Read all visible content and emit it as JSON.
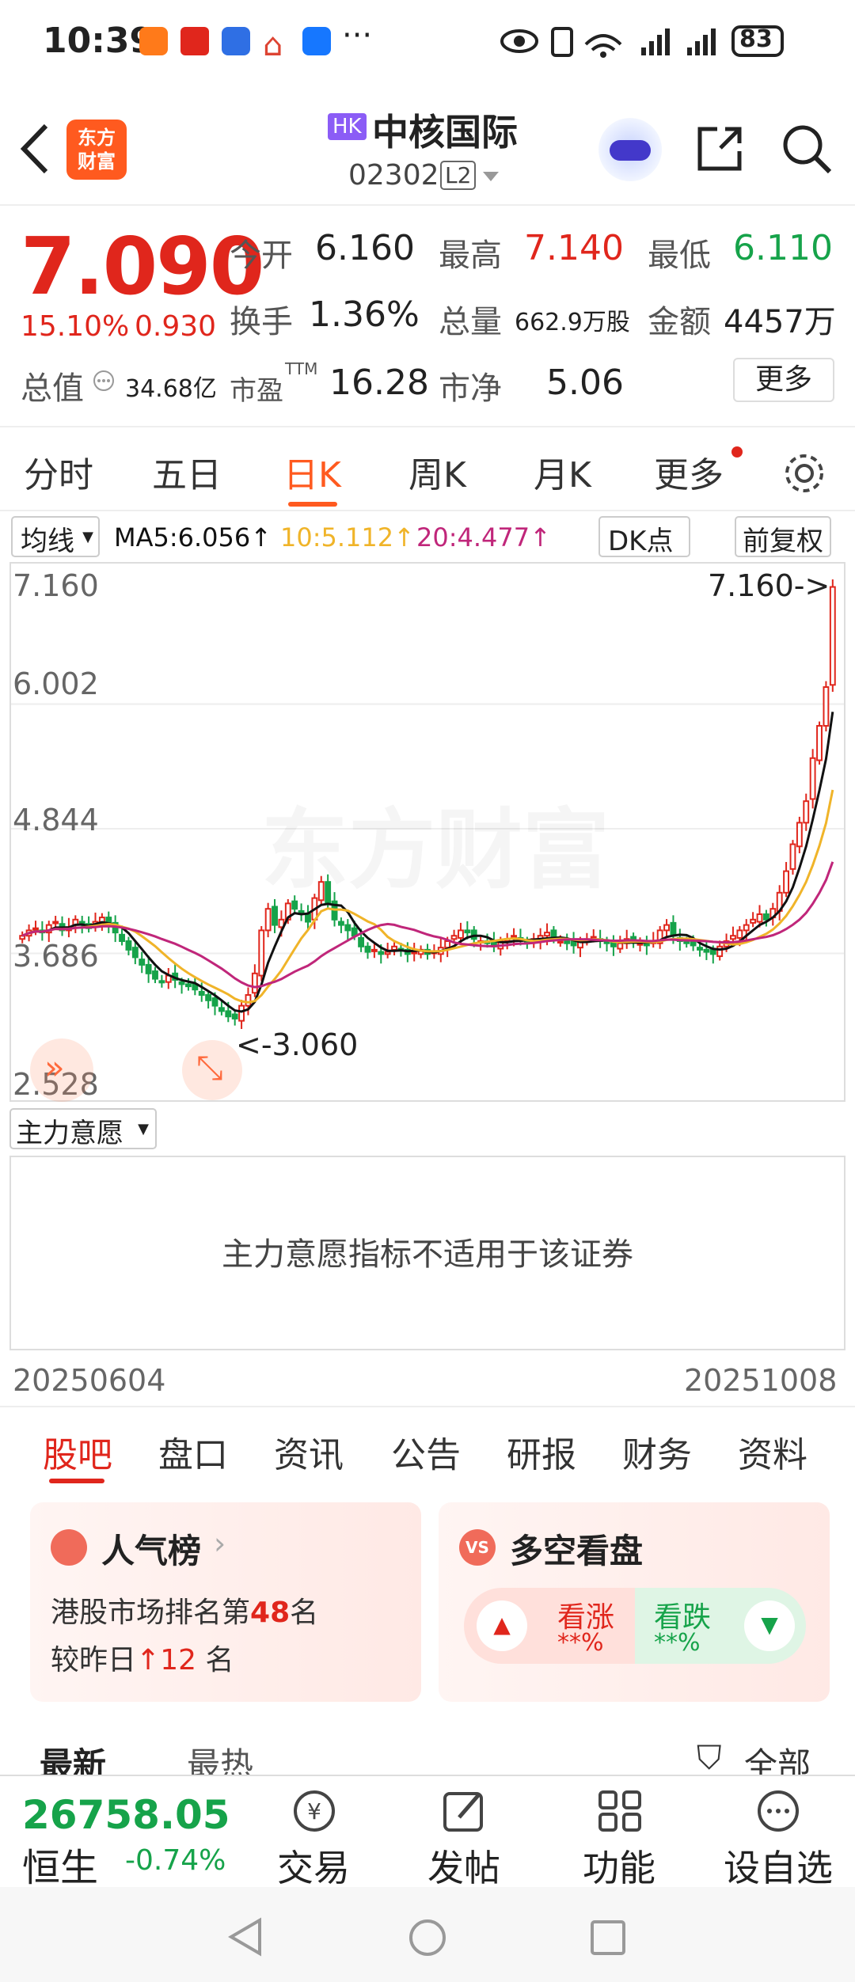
{
  "status_bar": {
    "time": "10:39",
    "more": "···",
    "battery": "83"
  },
  "header": {
    "logo_text": "东方\n财富",
    "market_badge": "HK",
    "stock_name": "中核国际",
    "stock_code": "02302",
    "level_badge": "L2"
  },
  "quote": {
    "price": "7.090",
    "change_pct": "15.10%",
    "change_amt": "0.930",
    "open_label": "今开",
    "open": "6.160",
    "high_label": "最高",
    "high": "7.140",
    "low_label": "最低",
    "low": "6.110",
    "turnover_label": "换手",
    "turnover": "1.36%",
    "volume_label": "总量",
    "volume": "662.9万股",
    "amount_label": "金额",
    "amount": "4457万",
    "mktcap_label": "总值",
    "mktcap": "34.68亿",
    "pe_label": "市盈",
    "pe_sup": "TTM",
    "pe": "16.28",
    "pb_label": "市净",
    "pb": "5.06",
    "more_button": "更多"
  },
  "periods": {
    "items": [
      "分时",
      "五日",
      "日K",
      "周K",
      "月K",
      "更多"
    ],
    "active": "日K"
  },
  "chart_toolbar": {
    "ma_select": "均线",
    "ma5": "MA5:6.056↑",
    "ma10": "10:5.112↑",
    "ma20": "20:4.477↑",
    "dk_button": "DK点",
    "adjust_button": "前复权",
    "colors": {
      "ma5": "#111111",
      "ma10": "#f0b429",
      "ma20": "#c0267a",
      "up": "#e0261c",
      "down": "#16a34a"
    }
  },
  "chart_data": {
    "type": "candlestick",
    "y_ticks": [
      "7.160",
      "6.002",
      "4.844",
      "3.686",
      "2.528"
    ],
    "ylim": [
      2.528,
      7.16
    ],
    "max_marker": "7.160->",
    "min_marker": "<-3.060",
    "watermark": "东方财富",
    "x_start": "20250604",
    "x_end": "20251008",
    "close": [
      3.85,
      3.9,
      3.92,
      3.88,
      3.95,
      3.98,
      3.9,
      3.93,
      4.0,
      3.96,
      3.92,
      3.98,
      4.02,
      3.95,
      3.88,
      3.8,
      3.72,
      3.65,
      3.58,
      3.5,
      3.45,
      3.42,
      3.48,
      3.44,
      3.4,
      3.38,
      3.35,
      3.3,
      3.25,
      3.2,
      3.15,
      3.1,
      3.08,
      3.2,
      3.3,
      3.5,
      3.9,
      4.1,
      3.95,
      4.0,
      4.15,
      4.1,
      4.05,
      3.98,
      4.2,
      4.35,
      4.15,
      4.0,
      3.95,
      3.9,
      3.85,
      3.75,
      3.7,
      3.72,
      3.68,
      3.7,
      3.75,
      3.72,
      3.68,
      3.7,
      3.72,
      3.68,
      3.7,
      3.74,
      3.8,
      3.85,
      3.9,
      3.88,
      3.82,
      3.8,
      3.78,
      3.75,
      3.8,
      3.82,
      3.85,
      3.8,
      3.78,
      3.82,
      3.85,
      3.88,
      3.82,
      3.8,
      3.78,
      3.76,
      3.8,
      3.82,
      3.84,
      3.8,
      3.78,
      3.75,
      3.78,
      3.82,
      3.8,
      3.78,
      3.76,
      3.8,
      3.9,
      3.95,
      3.85,
      3.8,
      3.78,
      3.76,
      3.72,
      3.7,
      3.68,
      3.75,
      3.8,
      3.85,
      3.9,
      3.95,
      4.0,
      4.05,
      4.0,
      4.1,
      4.25,
      4.45,
      4.7,
      4.9,
      5.1,
      5.5,
      5.8,
      6.16,
      7.09
    ],
    "ma5_last": 6.056,
    "ma10_last": 5.112,
    "ma20_last": 4.477
  },
  "indicator": {
    "select": "主力意愿",
    "message": "主力意愿指标不适用于该证券"
  },
  "info_tabs": {
    "items": [
      "股吧",
      "盘口",
      "资讯",
      "公告",
      "研报",
      "财务",
      "资料"
    ],
    "active": "股吧"
  },
  "cards": {
    "popularity": {
      "title": "人气榜",
      "line1_prefix": "港股市场排名第",
      "rank": "48",
      "line1_suffix": "名",
      "line2_prefix": "较昨日",
      "change": "12",
      "line2_suffix": "名"
    },
    "bullbear": {
      "title": "多空看盘",
      "up_label": "看涨",
      "up_pct": "**%",
      "down_label": "看跌",
      "down_pct": "**%"
    }
  },
  "sort": {
    "latest": "最新",
    "hot": "最热",
    "filter": "全部"
  },
  "bottom_nav": {
    "index_value": "26758.05",
    "index_name": "恒生",
    "index_change": "-0.74%",
    "items": [
      "交易",
      "发帖",
      "功能",
      "设自选"
    ]
  }
}
